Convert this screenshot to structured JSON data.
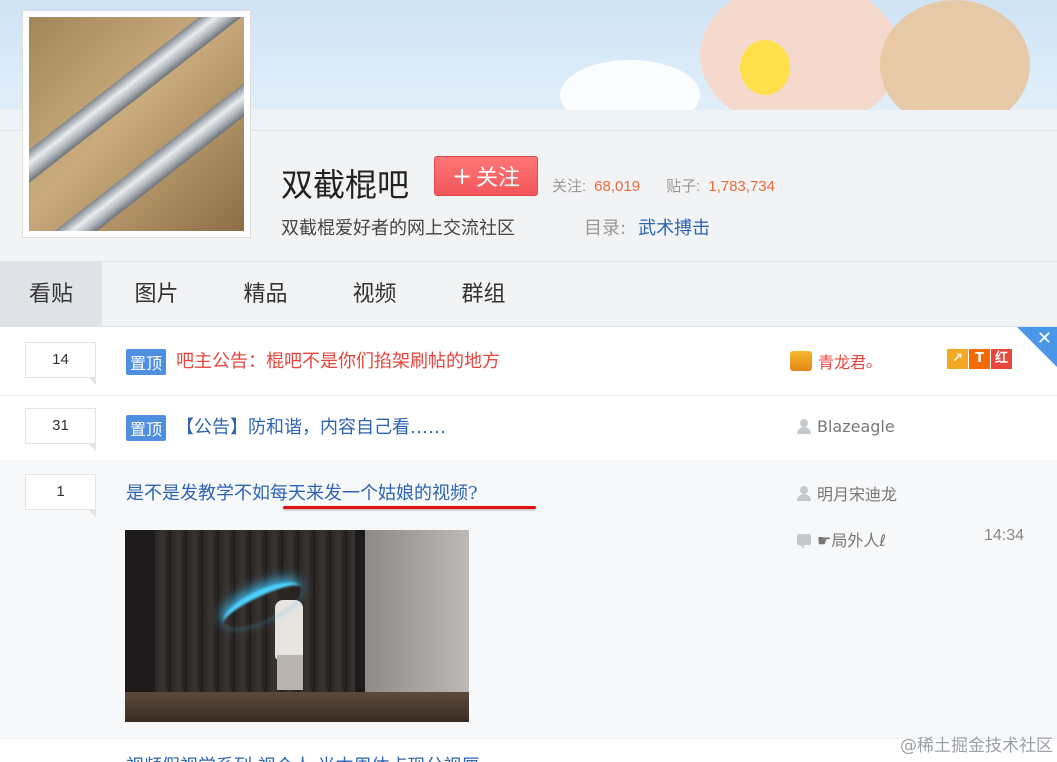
{
  "forum": {
    "name": "双截棍吧",
    "follow_label": "关注",
    "follow_plus": "+",
    "followers_label": "关注:",
    "followers_count": "68,019",
    "posts_label": "贴子:",
    "posts_count": "1,783,734",
    "slogan": "双截棍爱好者的网上交流社区",
    "dir_label": "目录:",
    "dir_value": "武术搏击"
  },
  "tabs": [
    "看贴",
    "图片",
    "精品",
    "视频",
    "群组"
  ],
  "threads": [
    {
      "replies": "14",
      "pinned": "置顶",
      "title": "吧主公告：棍吧不是你们掐架刷帖的地方",
      "author": "青龙君ₒ"
    },
    {
      "replies": "31",
      "pinned": "置顶",
      "title": "【公告】防和谐，内容自己看……",
      "author": "Blazeagle"
    },
    {
      "replies": "1",
      "title": "是不是发教学不如每天来发一个姑娘的视频?",
      "author": "明月宋迪龙",
      "last_reply": "☛局外人ℓ",
      "time": "14:34"
    }
  ],
  "partial_title": "视频假视学系列 视个人 光本周体点现分视厘",
  "badges": [
    "↗",
    "T",
    "红"
  ],
  "badge_colors": [
    "#f5a623",
    "#f56a00",
    "#e8453c"
  ],
  "watermark": "@稀土掘金技术社区",
  "close_glyph": "✕"
}
